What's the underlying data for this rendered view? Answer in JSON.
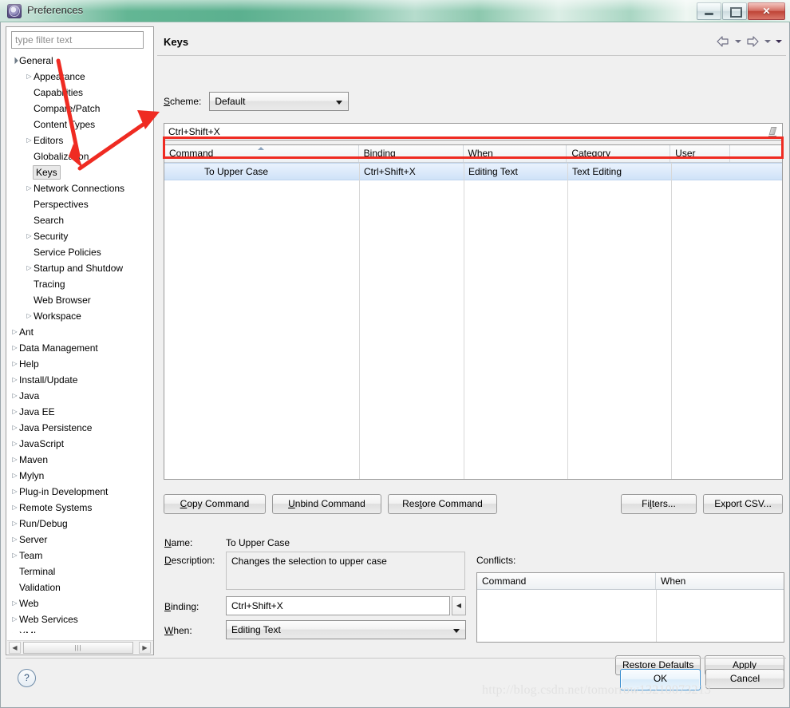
{
  "window": {
    "title": "Preferences",
    "icon": "preferences-gear-icon",
    "minimize_label": "–",
    "maximize_label": "□",
    "close_label": "✕"
  },
  "sidebar": {
    "filter_placeholder": "type filter text",
    "filter_value": "",
    "items": [
      {
        "label": "General",
        "depth": 1,
        "arrow": "expanded",
        "selected": false
      },
      {
        "label": "Appearance",
        "depth": 2,
        "arrow": "collapsed",
        "selected": false
      },
      {
        "label": "Capabilities",
        "depth": 2,
        "arrow": "none",
        "selected": false
      },
      {
        "label": "Compare/Patch",
        "depth": 2,
        "arrow": "none",
        "selected": false
      },
      {
        "label": "Content Types",
        "depth": 2,
        "arrow": "none",
        "selected": false
      },
      {
        "label": "Editors",
        "depth": 2,
        "arrow": "collapsed",
        "selected": false
      },
      {
        "label": "Globalization",
        "depth": 2,
        "arrow": "none",
        "selected": false
      },
      {
        "label": "Keys",
        "depth": 2,
        "arrow": "none",
        "selected": true
      },
      {
        "label": "Network Connections",
        "depth": 2,
        "arrow": "collapsed",
        "selected": false
      },
      {
        "label": "Perspectives",
        "depth": 2,
        "arrow": "none",
        "selected": false
      },
      {
        "label": "Search",
        "depth": 2,
        "arrow": "none",
        "selected": false
      },
      {
        "label": "Security",
        "depth": 2,
        "arrow": "collapsed",
        "selected": false
      },
      {
        "label": "Service Policies",
        "depth": 2,
        "arrow": "none",
        "selected": false
      },
      {
        "label": "Startup and Shutdow",
        "depth": 2,
        "arrow": "collapsed",
        "selected": false
      },
      {
        "label": "Tracing",
        "depth": 2,
        "arrow": "none",
        "selected": false
      },
      {
        "label": "Web Browser",
        "depth": 2,
        "arrow": "none",
        "selected": false
      },
      {
        "label": "Workspace",
        "depth": 2,
        "arrow": "collapsed",
        "selected": false
      },
      {
        "label": "Ant",
        "depth": 1,
        "arrow": "collapsed",
        "selected": false
      },
      {
        "label": "Data Management",
        "depth": 1,
        "arrow": "collapsed",
        "selected": false
      },
      {
        "label": "Help",
        "depth": 1,
        "arrow": "collapsed",
        "selected": false
      },
      {
        "label": "Install/Update",
        "depth": 1,
        "arrow": "collapsed",
        "selected": false
      },
      {
        "label": "Java",
        "depth": 1,
        "arrow": "collapsed",
        "selected": false
      },
      {
        "label": "Java EE",
        "depth": 1,
        "arrow": "collapsed",
        "selected": false
      },
      {
        "label": "Java Persistence",
        "depth": 1,
        "arrow": "collapsed",
        "selected": false
      },
      {
        "label": "JavaScript",
        "depth": 1,
        "arrow": "collapsed",
        "selected": false
      },
      {
        "label": "Maven",
        "depth": 1,
        "arrow": "collapsed",
        "selected": false
      },
      {
        "label": "Mylyn",
        "depth": 1,
        "arrow": "collapsed",
        "selected": false
      },
      {
        "label": "Plug-in Development",
        "depth": 1,
        "arrow": "collapsed",
        "selected": false
      },
      {
        "label": "Remote Systems",
        "depth": 1,
        "arrow": "collapsed",
        "selected": false
      },
      {
        "label": "Run/Debug",
        "depth": 1,
        "arrow": "collapsed",
        "selected": false
      },
      {
        "label": "Server",
        "depth": 1,
        "arrow": "collapsed",
        "selected": false
      },
      {
        "label": "Team",
        "depth": 1,
        "arrow": "collapsed",
        "selected": false
      },
      {
        "label": "Terminal",
        "depth": 1,
        "arrow": "none",
        "selected": false
      },
      {
        "label": "Validation",
        "depth": 1,
        "arrow": "none",
        "selected": false
      },
      {
        "label": "Web",
        "depth": 1,
        "arrow": "collapsed",
        "selected": false
      },
      {
        "label": "Web Services",
        "depth": 1,
        "arrow": "collapsed",
        "selected": false
      },
      {
        "label": "XML",
        "depth": 1,
        "arrow": "collapsed",
        "selected": false
      }
    ]
  },
  "page": {
    "title": "Keys",
    "nav": {
      "back_icon": "back-arrow-icon",
      "back_caret_icon": "chevron-down-icon",
      "forward_icon": "forward-arrow-icon",
      "forward_caret_icon": "chevron-down-icon",
      "menu_icon": "view-menu-triangle-icon"
    },
    "scheme": {
      "label": "Scheme:",
      "value": "Default",
      "options": [
        "Default"
      ]
    },
    "binding_filter": {
      "value": "Ctrl+Shift+X",
      "clear_icon": "eraser-icon"
    },
    "table": {
      "columns": [
        "Command",
        "Binding",
        "When",
        "Category",
        "User"
      ],
      "sorted_column": "Command",
      "sort_direction": "ascending",
      "rows": [
        {
          "command": "To Upper Case",
          "binding": "Ctrl+Shift+X",
          "when": "Editing Text",
          "category": "Text Editing",
          "user": ""
        }
      ]
    },
    "command_buttons": [
      {
        "label": "Copy Command",
        "mnemonic": "C"
      },
      {
        "label": "Unbind Command",
        "mnemonic": "U"
      },
      {
        "label": "Restore Command",
        "mnemonic": "t"
      }
    ],
    "right_buttons": [
      {
        "label": "Filters...",
        "mnemonic": "l"
      },
      {
        "label": "Export CSV...",
        "mnemonic": ""
      }
    ],
    "details": {
      "name_label": "Name:",
      "name_value": "To Upper Case",
      "description_label": "Description:",
      "description_value": "Changes the selection to upper case",
      "binding_label": "Binding:",
      "binding_value": "Ctrl+Shift+X",
      "binding_side_icon": "left-chevron-icon",
      "when_label": "When:",
      "when_value": "Editing Text"
    },
    "conflicts": {
      "label": "Conflicts:",
      "columns": [
        "Command",
        "When"
      ],
      "rows": []
    },
    "restore_defaults_label": "Restore Defaults",
    "apply_label": "Apply"
  },
  "footer": {
    "help_icon": "help-question-icon",
    "ok_label": "OK",
    "cancel_label": "Cancel",
    "watermark": "http://blog.csdn.net/tomorrow13210073213"
  },
  "annotations": {
    "highlight_color": "#ef2b22",
    "arrow1": "arrow-pointing-to-keys-tree-item",
    "arrow2": "arrow-pointing-from-keys-to-binding-row"
  }
}
